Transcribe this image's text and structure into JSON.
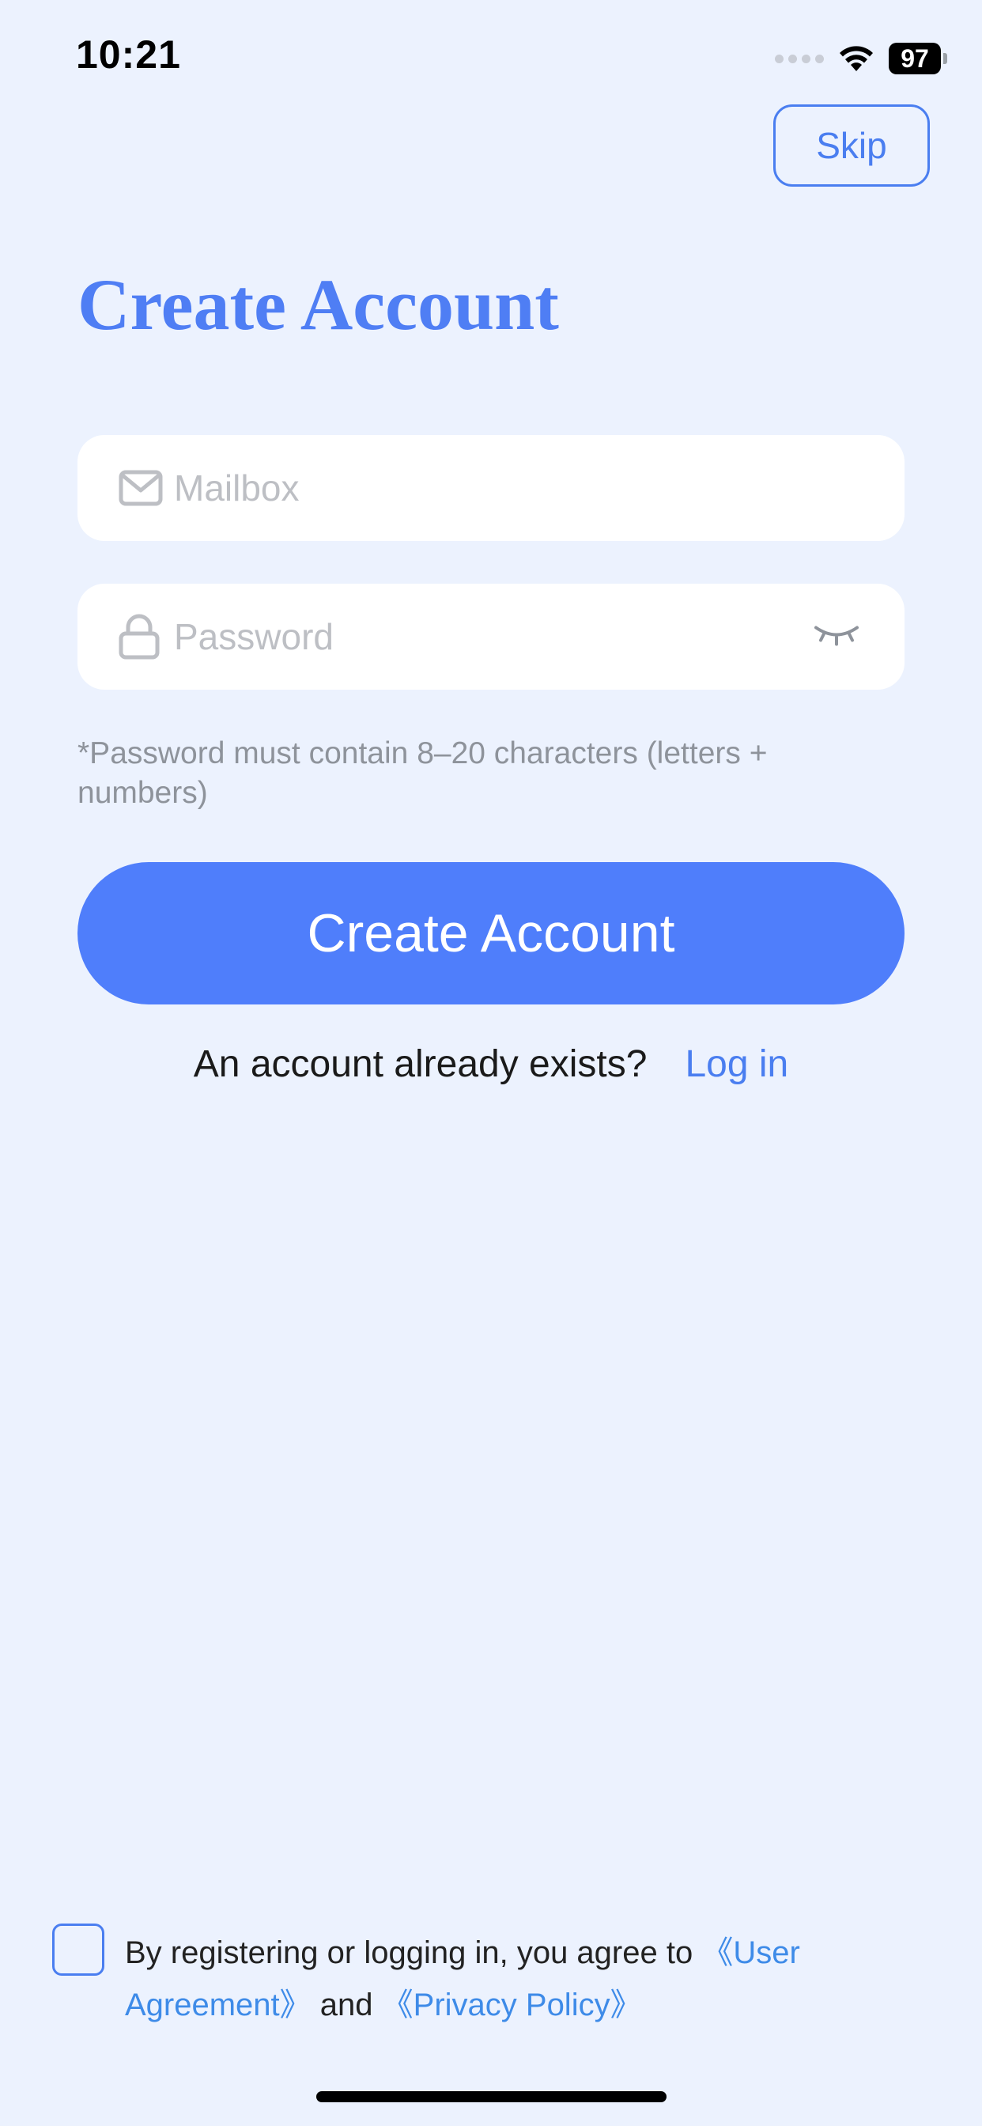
{
  "status_bar": {
    "time": "10:21",
    "battery": "97"
  },
  "header": {
    "skip_label": "Skip"
  },
  "title": "Create Account",
  "form": {
    "mailbox_placeholder": "Mailbox",
    "password_placeholder": "Password",
    "password_hint": "*Password must contain 8–20 characters (letters + numbers)",
    "submit_label": "Create Account"
  },
  "login": {
    "prompt": "An account already exists?",
    "link_label": "Log in"
  },
  "agreement": {
    "text_before": "By registering or logging in, you agree to ",
    "user_agreement": "《User Agreement》",
    "and": " and ",
    "privacy_policy": "《Privacy Policy》"
  },
  "colors": {
    "background": "#ECF2FE",
    "accent": "#4F7EF4",
    "button": "#4F7EFB",
    "link": "#4A7EF0"
  },
  "icons": {
    "mailbox": "mail-icon",
    "password": "lock-icon",
    "visibility": "eye-closed-icon",
    "wifi": "wifi-icon",
    "cellular": "signal-icon",
    "battery": "battery-icon"
  }
}
